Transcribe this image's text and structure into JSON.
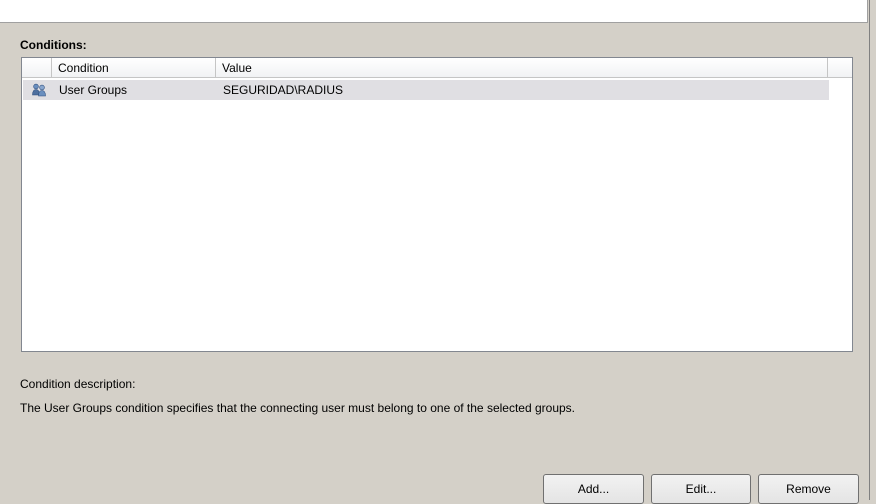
{
  "conditions_label": "Conditions:",
  "table": {
    "columns": [
      "Condition",
      "Value"
    ],
    "rows": [
      {
        "icon": "user-group-icon",
        "condition": "User Groups",
        "value": "SEGURIDAD\\RADIUS"
      }
    ]
  },
  "description": {
    "label": "Condition description:",
    "text": "The User Groups condition specifies that the connecting user must belong to one of the selected groups."
  },
  "buttons": {
    "add": "Add...",
    "edit": "Edit...",
    "remove": "Remove"
  },
  "colors": {
    "dialog_bg": "#d4d0c8",
    "selected_row": "#e0dfe3"
  }
}
